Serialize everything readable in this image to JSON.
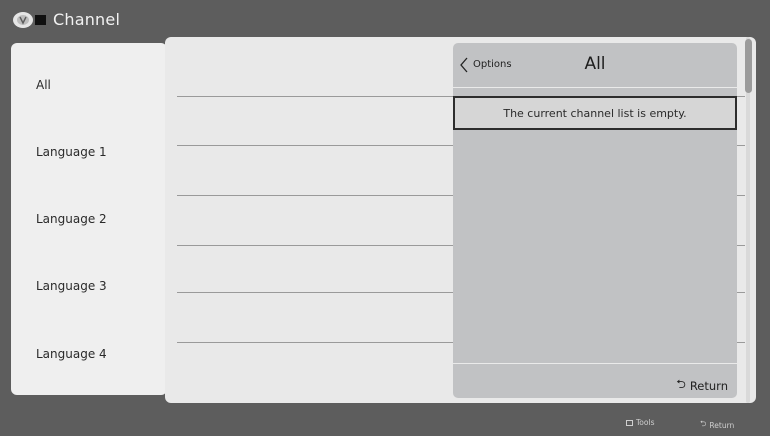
{
  "header": {
    "title": "Channel",
    "icon": "channel-icon"
  },
  "sidebar": {
    "items": [
      {
        "label": "All"
      },
      {
        "label": "Language 1"
      },
      {
        "label": "Language 2"
      },
      {
        "label": "Language 3"
      },
      {
        "label": "Language 4"
      }
    ]
  },
  "panel": {
    "back_label": "Options",
    "title": "All",
    "empty_message": "The current channel list is empty.",
    "return_label": "Return"
  },
  "footer_hints": {
    "tools_label": "Tools",
    "return_label": "Return"
  },
  "colors": {
    "background": "#5d5d5d",
    "sidebar": "#efefef",
    "main": "#e9e9e9",
    "panel": "#c1c2c4"
  }
}
